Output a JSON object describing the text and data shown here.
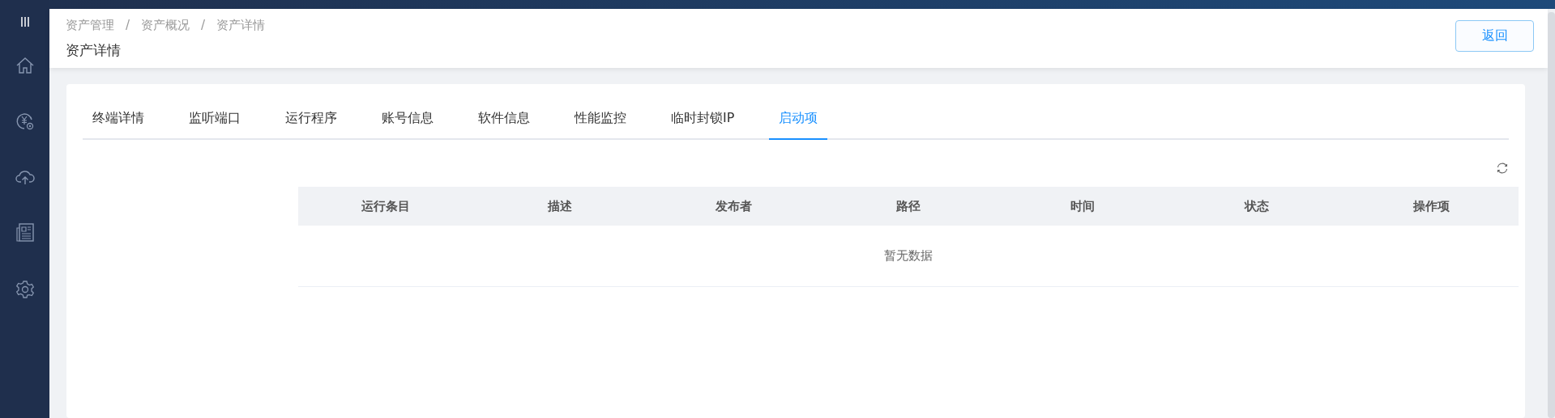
{
  "sidebar": {
    "items": [
      {
        "kind": "menu"
      },
      {
        "kind": "home"
      },
      {
        "kind": "finance"
      },
      {
        "kind": "upload"
      },
      {
        "kind": "news"
      },
      {
        "kind": "settings"
      }
    ]
  },
  "header": {
    "breadcrumb": [
      "资产管理",
      "资产概况",
      "资产详情"
    ],
    "separator": "/",
    "title": "资产详情",
    "back_button": "返回"
  },
  "tabs": [
    {
      "label": "终端详情",
      "selected": false
    },
    {
      "label": "监听端口",
      "selected": false
    },
    {
      "label": "运行程序",
      "selected": false
    },
    {
      "label": "账号信息",
      "selected": false
    },
    {
      "label": "软件信息",
      "selected": false
    },
    {
      "label": "性能监控",
      "selected": false
    },
    {
      "label": "临时封锁IP",
      "selected": false
    },
    {
      "label": "启动项",
      "selected": true
    }
  ],
  "table": {
    "columns": [
      "运行条目",
      "描述",
      "发布者",
      "路径",
      "时间",
      "状态",
      "操作项"
    ],
    "empty_text": "暂无数据"
  }
}
